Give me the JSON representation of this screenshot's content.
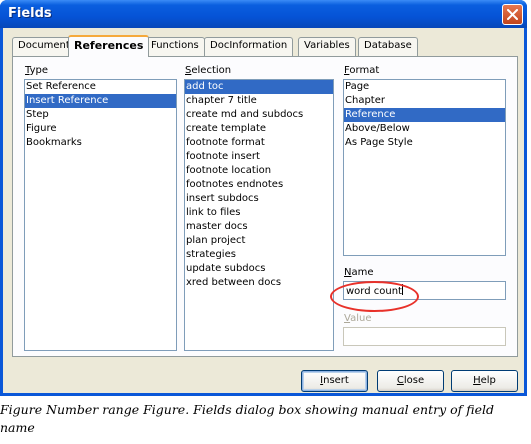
{
  "window": {
    "title": "Fields",
    "close_icon": "close-icon"
  },
  "tabs": [
    {
      "label": "Document"
    },
    {
      "label": "References",
      "active": true
    },
    {
      "label": "Functions"
    },
    {
      "label": "DocInformation"
    },
    {
      "label": "Variables"
    },
    {
      "label": "Database"
    }
  ],
  "type": {
    "label_hotkey": "T",
    "label_rest": "ype",
    "items": [
      "Set Reference",
      "Insert Reference",
      "Step",
      "Figure",
      "Bookmarks"
    ],
    "selected": "Insert Reference"
  },
  "selection": {
    "label_hotkey": "S",
    "label_rest": "election",
    "items": [
      "add toc",
      "chapter 7 title",
      "create md and subdocs",
      "create template",
      "footnote format",
      "footnote insert",
      "footnote location",
      "footnotes endnotes",
      "insert subdocs",
      "link to files",
      "master docs",
      "plan project",
      "strategies",
      "update subdocs",
      "xred between docs"
    ],
    "selected": "add toc"
  },
  "format": {
    "label_hotkey": "F",
    "label_rest": "ormat",
    "items": [
      "Page",
      "Chapter",
      "Reference",
      "Above/Below",
      "As Page Style"
    ],
    "selected": "Reference"
  },
  "name": {
    "label_hotkey": "N",
    "label_rest": "ame",
    "value": "word count"
  },
  "value_field": {
    "label_hotkey": "V",
    "label_rest": "alue",
    "value": ""
  },
  "buttons": {
    "insert": {
      "hotkey": "I",
      "rest": "nsert"
    },
    "close": {
      "hotkey": "C",
      "rest": "lose"
    },
    "help": {
      "hotkey": "H",
      "rest": "elp"
    }
  },
  "annotation_color": "#e8312a",
  "selection_color": "#316ac5",
  "caption": "Figure Number range Figure. Fields dialog box showing manual entry of field name"
}
